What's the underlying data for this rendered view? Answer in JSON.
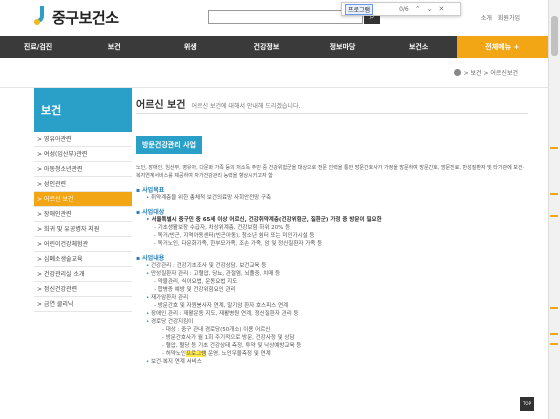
{
  "find": {
    "query": "프로그램",
    "count": "0/6"
  },
  "header": {
    "logo_text": "중구보건소",
    "top_links": [
      "소개",
      "회원가입"
    ],
    "search_button": "검색"
  },
  "nav": {
    "items": [
      "진료/검진",
      "보건",
      "위생",
      "건강정보",
      "정보마당",
      "보건소"
    ],
    "special": "전체메뉴 +"
  },
  "breadcrumb": "> 보건 > 어르신보건",
  "sidebar": {
    "title": "보건",
    "items": [
      {
        "label": "> 영유아관련",
        "active": false
      },
      {
        "label": "> 여성(임산부)관련",
        "active": false
      },
      {
        "label": "> 아동청소년관련",
        "active": false
      },
      {
        "label": "> 성인관련",
        "active": false
      },
      {
        "label": "> 어르신 보건",
        "active": true
      },
      {
        "label": "> 장애인관련",
        "active": false
      },
      {
        "label": "> 희귀 및 유공병자 지원",
        "active": false
      },
      {
        "label": "> 어린이건강체험관",
        "active": false
      },
      {
        "label": "> 심폐소생술교육",
        "active": false
      },
      {
        "label": "> 건강관리실 소개",
        "active": false
      },
      {
        "label": "> 정신건강관련",
        "active": false
      },
      {
        "label": "> 금연 클리닉",
        "active": false
      }
    ]
  },
  "content": {
    "title": "어르신 보건",
    "desc": "어르신 보건에 대해서 안내해 드리겠습니다.",
    "section_title": "방문건강관리 사업",
    "intro": "노인, 장애인, 임산부, 영유아, 다문화 가족 등의 저소득 주민 중 건강위험군을 대상으로 전문 인력을 통한 방문간호사가 가정을 방문하여 방문간호, 방문진료, 만성질환자 및 타기관에 보건·복지연계서비스를 제공하여 자가건강관리 능력을 향상시키고자 함",
    "goal_heading": "사업목표",
    "goal_items": [
      "취약계층을 위한 총체적 보건의료망 사회안전망 구축"
    ],
    "target_heading": "사업대상",
    "target_main": "서울특별시 중구민 중 65세 이상 어르신, 건강취약계층(건강위험군, 질환군) 가정 중 방문이 필요한",
    "target_items": [
      "기초생활보장 수급자, 차상위계층, 건강보험 하위 20% 등",
      "독거/빈곤, 지역아동센터(빈곤아동), 청소년 쉼터 또는 미인가시설 등",
      "독거노인, 다문화가족, 한부모가족, 조손 가족, 암 및 정신질환자 가족 등"
    ],
    "content_heading": "사업내용",
    "content_items": [
      {
        "type": "bullet",
        "text": "건강관리 : 건강기초조사 및 건강상담, 보건교육 등"
      },
      {
        "type": "bullet",
        "text": "만성질환자 관리 : 고혈압, 당뇨, 관절염, 뇌졸중, 치매 등"
      },
      {
        "type": "sub",
        "text": "약물관리, 식이요법, 운동요법 지도"
      },
      {
        "type": "sub",
        "text": "합병증 예방 및 건강위험요인 관리"
      },
      {
        "type": "bullet",
        "text": "재가암환자 관리"
      },
      {
        "type": "sub",
        "text": "방문간호 및 자원봉사자 연계, 말기암 환자 호스피스 연계"
      },
      {
        "type": "bullet",
        "text": "장애인 관리 : 재활운동 지도, 재활병원 연계, 정신질환자 관리 등"
      },
      {
        "type": "bullet",
        "text": "경로당 건강지킴이"
      },
      {
        "type": "subsub",
        "text": "대상 : 중구 관내 경로당(50개소) 이용 어르신"
      },
      {
        "type": "subsub",
        "text": "방문간호사가 월 1회 주기적으로 방문, 건강사정 및 상담"
      },
      {
        "type": "subsub",
        "text": "혈압, 혈당 등 기초 건강상태 측정, 투약 및 낙상예방교육 등"
      },
      {
        "type": "subsub_hl",
        "pre": "허약노인",
        "hl": "프로그램",
        "post": " 운영, 노인우울측정 및 연계"
      },
      {
        "type": "bullet",
        "text": "보건·복지 연계 서비스"
      }
    ]
  },
  "top_button": "TOP"
}
